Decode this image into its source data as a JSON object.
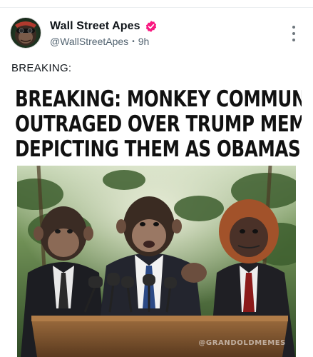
{
  "post": {
    "author": {
      "display_name": "Wall Street Apes",
      "handle": "@WallStreetApes",
      "time": "9h",
      "verified_badge_icon": "verified-badge-icon",
      "verified_color": "#F91880"
    },
    "text": "BREAKING:",
    "media": {
      "headline_lines": [
        "BREAKING: MONKEY COMMUNITY",
        "OUTRAGED OVER TRUMP MEME",
        "DEPICTING THEM AS OBAMAS"
      ],
      "watermark": "@GRANDOLDMEMES"
    },
    "more_icon": "more-options-icon"
  },
  "colors": {
    "text_primary": "#0F1419",
    "text_secondary": "#536471"
  }
}
